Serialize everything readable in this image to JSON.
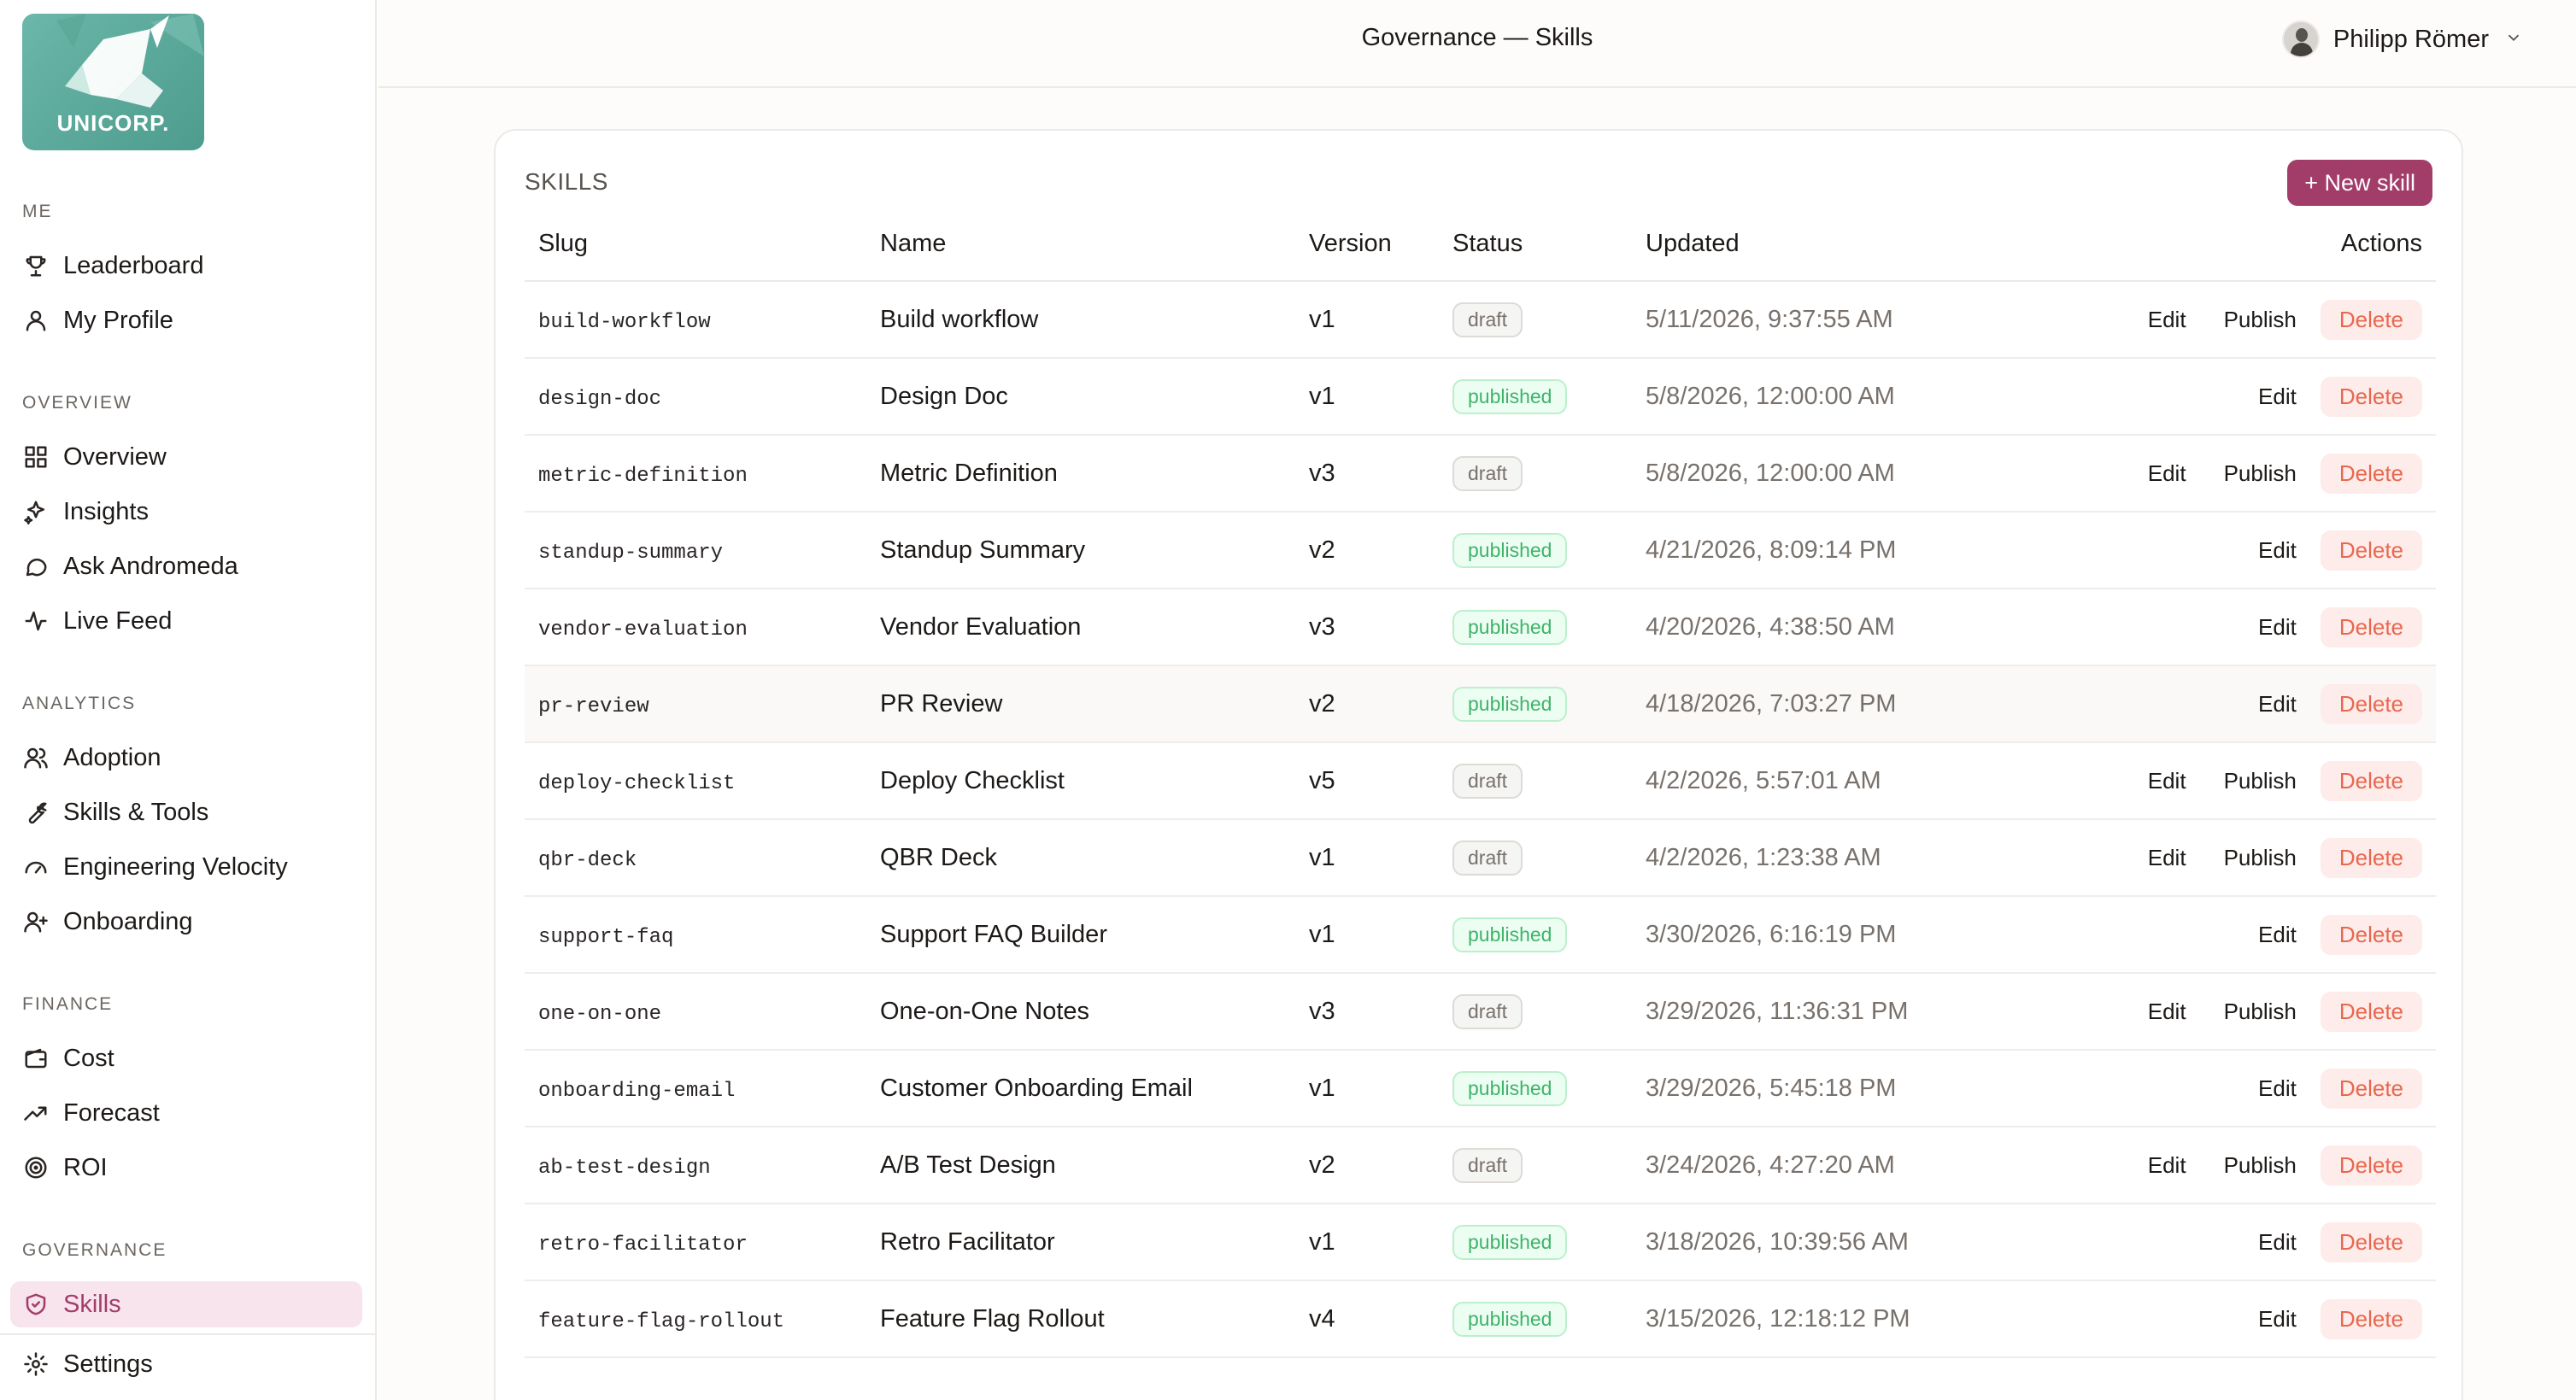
{
  "brand": {
    "name": "UNICORP."
  },
  "header": {
    "title": "Governance — Skills",
    "user_name": "Philipp Römer"
  },
  "sidebar": {
    "sections": [
      {
        "label": "ME",
        "items": [
          {
            "label": "Leaderboard",
            "icon": "trophy-icon"
          },
          {
            "label": "My Profile",
            "icon": "user-icon"
          }
        ]
      },
      {
        "label": "OVERVIEW",
        "items": [
          {
            "label": "Overview",
            "icon": "grid-icon"
          },
          {
            "label": "Insights",
            "icon": "sparkles-icon"
          },
          {
            "label": "Ask Andromeda",
            "icon": "chat-bubble-icon"
          },
          {
            "label": "Live Feed",
            "icon": "activity-icon"
          }
        ]
      },
      {
        "label": "ANALYTICS",
        "items": [
          {
            "label": "Adoption",
            "icon": "users-icon"
          },
          {
            "label": "Skills & Tools",
            "icon": "wrench-icon"
          },
          {
            "label": "Engineering Velocity",
            "icon": "gauge-icon"
          },
          {
            "label": "Onboarding",
            "icon": "user-plus-icon"
          }
        ]
      },
      {
        "label": "FINANCE",
        "items": [
          {
            "label": "Cost",
            "icon": "wallet-icon"
          },
          {
            "label": "Forecast",
            "icon": "trending-up-icon"
          },
          {
            "label": "ROI",
            "icon": "target-icon"
          }
        ]
      },
      {
        "label": "GOVERNANCE",
        "items": [
          {
            "label": "Skills",
            "icon": "shield-icon",
            "active": true
          }
        ]
      }
    ],
    "settings": {
      "label": "Settings",
      "icon": "gear-icon"
    }
  },
  "card": {
    "title": "SKILLS",
    "new_button": "+ New skill",
    "columns": [
      "Slug",
      "Name",
      "Version",
      "Status",
      "Updated",
      "Actions"
    ],
    "action_labels": {
      "edit": "Edit",
      "publish": "Publish",
      "delete": "Delete"
    },
    "rows": [
      {
        "slug": "build-workflow",
        "name": "Build workflow",
        "version": "v1",
        "status": "draft",
        "updated": "5/11/2026, 9:37:55 AM"
      },
      {
        "slug": "design-doc",
        "name": "Design Doc",
        "version": "v1",
        "status": "published",
        "updated": "5/8/2026, 12:00:00 AM"
      },
      {
        "slug": "metric-definition",
        "name": "Metric Definition",
        "version": "v3",
        "status": "draft",
        "updated": "5/8/2026, 12:00:00 AM"
      },
      {
        "slug": "standup-summary",
        "name": "Standup Summary",
        "version": "v2",
        "status": "published",
        "updated": "4/21/2026, 8:09:14 PM"
      },
      {
        "slug": "vendor-evaluation",
        "name": "Vendor Evaluation",
        "version": "v3",
        "status": "published",
        "updated": "4/20/2026, 4:38:50 AM"
      },
      {
        "slug": "pr-review",
        "name": "PR Review",
        "version": "v2",
        "status": "published",
        "updated": "4/18/2026, 7:03:27 PM"
      },
      {
        "slug": "deploy-checklist",
        "name": "Deploy Checklist",
        "version": "v5",
        "status": "draft",
        "updated": "4/2/2026, 5:57:01 AM"
      },
      {
        "slug": "qbr-deck",
        "name": "QBR Deck",
        "version": "v1",
        "status": "draft",
        "updated": "4/2/2026, 1:23:38 AM"
      },
      {
        "slug": "support-faq",
        "name": "Support FAQ Builder",
        "version": "v1",
        "status": "published",
        "updated": "3/30/2026, 6:16:19 PM"
      },
      {
        "slug": "one-on-one",
        "name": "One-on-One Notes",
        "version": "v3",
        "status": "draft",
        "updated": "3/29/2026, 11:36:31 PM"
      },
      {
        "slug": "onboarding-email",
        "name": "Customer Onboarding Email",
        "version": "v1",
        "status": "published",
        "updated": "3/29/2026, 5:45:18 PM"
      },
      {
        "slug": "ab-test-design",
        "name": "A/B Test Design",
        "version": "v2",
        "status": "draft",
        "updated": "3/24/2026, 4:27:20 AM"
      },
      {
        "slug": "retro-facilitator",
        "name": "Retro Facilitator",
        "version": "v1",
        "status": "published",
        "updated": "3/18/2026, 10:39:56 AM"
      },
      {
        "slug": "feature-flag-rollout",
        "name": "Feature Flag Rollout",
        "version": "v4",
        "status": "published",
        "updated": "3/15/2026, 12:18:12 PM"
      }
    ]
  }
}
